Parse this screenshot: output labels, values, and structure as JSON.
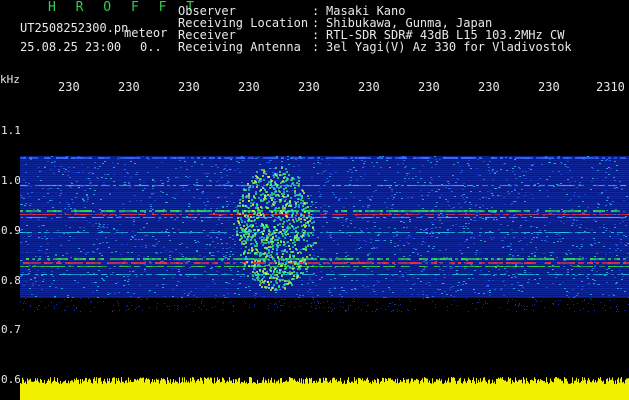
{
  "header": {
    "station": "H R O F F T",
    "filename": "UT2508252300.pn",
    "mode": "meteor",
    "datetime": "25.08.25 23:00",
    "count": "0..",
    "fields": [
      {
        "label": "Observer",
        "value": "Masaki Kano"
      },
      {
        "label": "Receiving Location",
        "value": "Shibukawa, Gunma, Japan"
      },
      {
        "label": "Receiver",
        "value": "RTL-SDR SDR# 43dB L15 103.2MHz CW"
      },
      {
        "label": "Receiving Antenna",
        "value": "3el Yagi(V) Az 330 for Vladivostok"
      }
    ]
  },
  "axis": {
    "unit": "kHz",
    "x_ticks": [
      "230",
      "230",
      "230",
      "230",
      "230",
      "230",
      "230",
      "230",
      "230",
      "2310"
    ],
    "y_ticks": [
      "1.1",
      "1.0",
      "0.9",
      "0.8",
      "0.7",
      "0.6"
    ]
  },
  "colors": {
    "header_green": "#2fcf50",
    "text": "#e8e8e8",
    "noise_bar": "#f0f000"
  }
}
